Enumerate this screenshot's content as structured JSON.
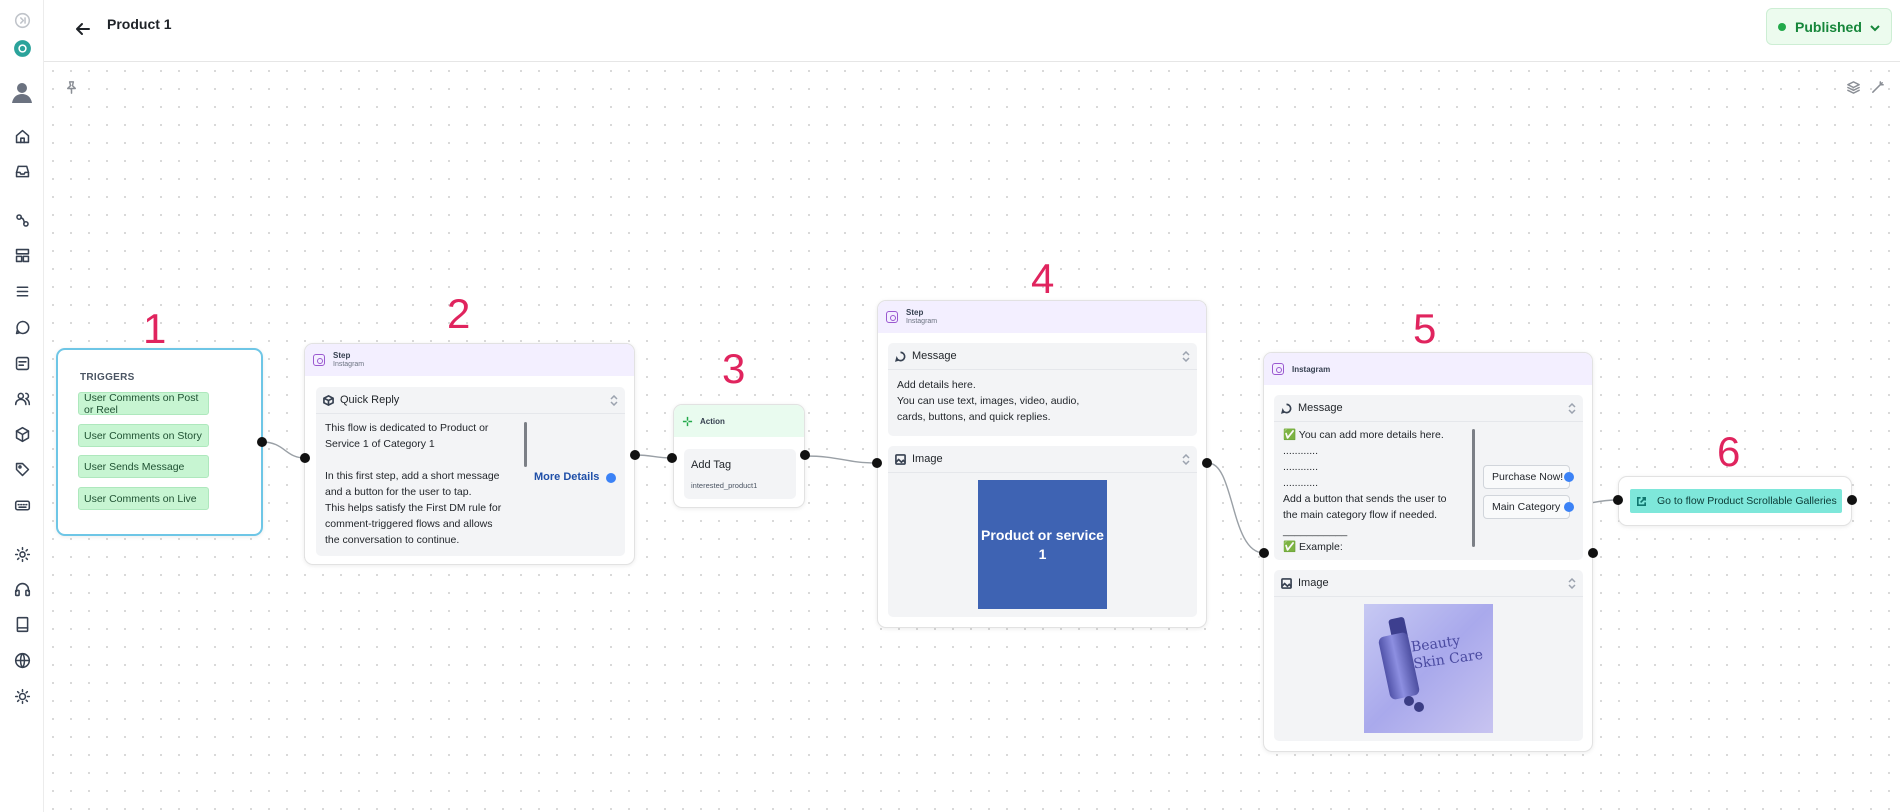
{
  "header": {
    "title": "Product 1",
    "status_label": "Published",
    "status_color": "#22a94a"
  },
  "sidebar": {
    "icons": [
      "collapse-icon",
      "logo-icon",
      "avatar-icon",
      "home-icon",
      "inbox-icon",
      "flows-icon",
      "templates-icon",
      "list-icon",
      "chat-icon",
      "forms-icon",
      "contacts-icon",
      "box-icon",
      "tag-icon",
      "keyboard-icon",
      "settings-icon",
      "support-icon",
      "book-icon",
      "globe-icon",
      "theme-icon"
    ]
  },
  "annotations": [
    "1",
    "2",
    "3",
    "4",
    "5",
    "6"
  ],
  "triggers": {
    "title": "TRIGGERS",
    "items": [
      "User Comments on Post or Reel",
      "User Comments on Story",
      "User Sends Message",
      "User Comments on Live"
    ]
  },
  "step2": {
    "head_title": "Step",
    "head_sub": "Instagram",
    "panel_title": "Quick Reply",
    "lines": [
      "This flow is dedicated to Product or",
      "Service 1 of Category 1",
      "",
      "In this first step, add a short message",
      "and a button for the user to tap.",
      "This helps satisfy the First DM rule for",
      "comment-triggered flows and allows",
      "the conversation to continue."
    ],
    "button_label": "More Details"
  },
  "action3": {
    "head_title": "Action",
    "panel_title": "Add Tag",
    "tag": "interested_product1"
  },
  "step4": {
    "head_title": "Step",
    "head_sub": "Instagram",
    "message_title": "Message",
    "message_lines": [
      "Add details here.",
      "You can use text, images, video, audio,",
      "cards, buttons, and quick replies."
    ],
    "image_title": "Image",
    "image_text_1": "Product or service",
    "image_text_2": "1"
  },
  "step5": {
    "head_title": "Instagram",
    "message_title": "Message",
    "message_lines": [
      "✅ You can add more details here.",
      "............",
      "............",
      "............",
      "Add a button that sends the user to",
      "the main category flow if needed.",
      "___________",
      "✅ Example:"
    ],
    "buttons": [
      "Purchase Now!",
      "Main Category"
    ],
    "image_title": "Image",
    "image_text": "Beauty Skin Care"
  },
  "goto6": {
    "label": "Go to flow Product Scrollable Galleries"
  }
}
